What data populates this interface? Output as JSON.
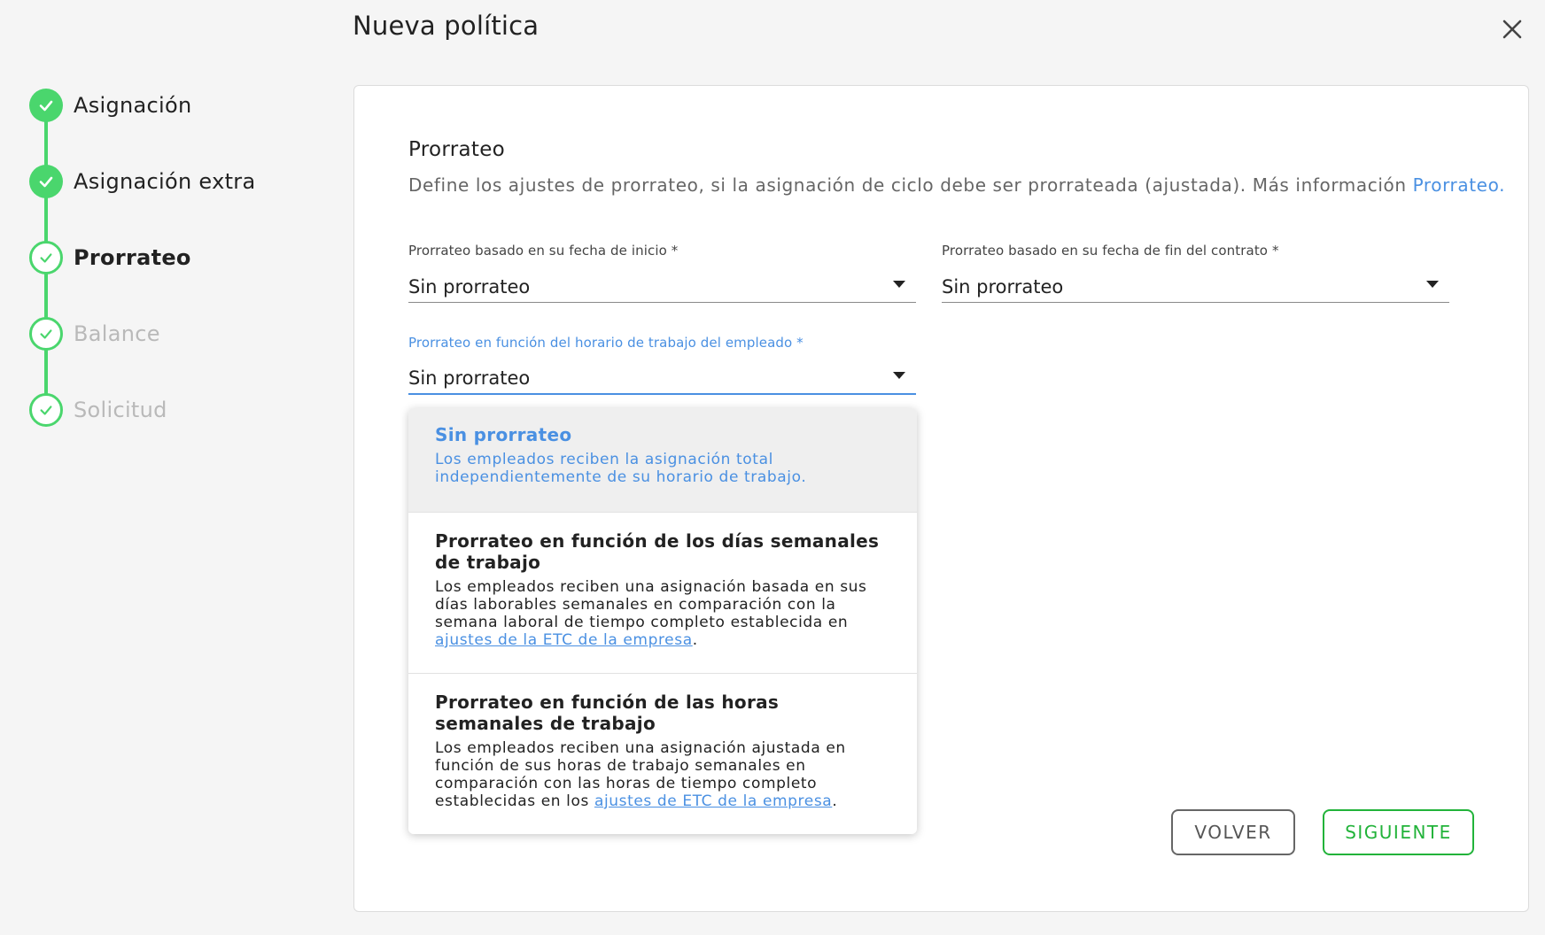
{
  "modal": {
    "title": "Nueva política"
  },
  "stepper": {
    "steps": [
      {
        "label": "Asignación",
        "state": "completed"
      },
      {
        "label": "Asignación extra",
        "state": "completed"
      },
      {
        "label": "Prorrateo",
        "state": "current"
      },
      {
        "label": "Balance",
        "state": "pending"
      },
      {
        "label": "Solicitud",
        "state": "pending"
      }
    ]
  },
  "section": {
    "title": "Prorrateo",
    "description": "Define los ajustes de prorrateo, si la asignación de ciclo debe ser prorrateada (ajustada). Más información ",
    "link": "Prorrateo."
  },
  "fields": {
    "start_date": {
      "label": "Prorrateo basado en su fecha de inicio *",
      "value": "Sin prorrateo"
    },
    "end_date": {
      "label": "Prorrateo basado en su fecha de fin del contrato *",
      "value": "Sin prorrateo"
    },
    "schedule": {
      "label": "Prorrateo en función del horario de trabajo del empleado *",
      "value": "Sin prorrateo"
    }
  },
  "dropdown": {
    "options": [
      {
        "title": "Sin prorrateo",
        "description": "Los empleados reciben la asignación total independientemente de su horario de trabajo.",
        "selected": true
      },
      {
        "title": "Prorrateo en función de los días semanales de trabajo",
        "description": "Los empleados reciben una asignación basada en sus días laborables semanales en comparación con la semana laboral de tiempo completo establecida en ",
        "link": "ajustes de la ETC de la empresa",
        "suffix": "."
      },
      {
        "title": "Prorrateo en función de las horas semanales de trabajo",
        "description": "Los empleados reciben una asignación ajustada en función de sus horas de trabajo semanales en comparación con las horas de tiempo completo establecidas en los ",
        "link": "ajustes de ETC de la empresa",
        "suffix": "."
      }
    ]
  },
  "buttons": {
    "back": "VOLVER",
    "next": "SIGUIENTE"
  },
  "colors": {
    "accent_green": "#4ad66d",
    "button_green": "#22b33a",
    "link_blue": "#4a90e2"
  },
  "icons": {
    "close": "close-icon",
    "check": "check-icon",
    "dropdown": "chevron-down-icon"
  }
}
